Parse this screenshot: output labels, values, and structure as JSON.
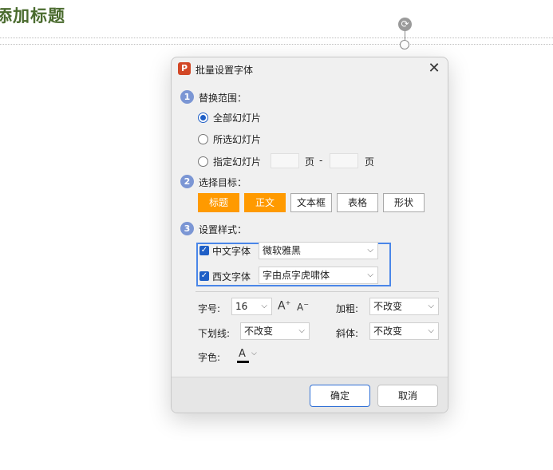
{
  "slide": {
    "title": "添加标题"
  },
  "dialog": {
    "title": "批量设置字体",
    "app_icon": "P",
    "close_glyph": "✕",
    "section1": {
      "num": "1",
      "label": "替换范围："
    },
    "range_options": [
      {
        "label": "全部幻灯片",
        "checked": true
      },
      {
        "label": "所选幻灯片",
        "checked": false
      },
      {
        "label": "指定幻灯片",
        "checked": false
      }
    ],
    "page_unit": "页",
    "page_dash": "-",
    "section2": {
      "num": "2",
      "label": "选择目标："
    },
    "targets": [
      "标题",
      "正文",
      "文本框",
      "表格",
      "形状"
    ],
    "section3": {
      "num": "3",
      "label": "设置样式："
    },
    "cn_font": {
      "label": "中文字体",
      "value": "微软雅黑"
    },
    "en_font": {
      "label": "西文字体",
      "value": "字由点字虎啸体"
    },
    "size": {
      "label": "字号:",
      "value": "16"
    },
    "grow_glyph": "A",
    "shrink_glyph": "A",
    "bold": {
      "label": "加粗:",
      "value": "不改变"
    },
    "underline": {
      "label": "下划线:",
      "value": "不改变"
    },
    "italic": {
      "label": "斜体:",
      "value": "不改变"
    },
    "color": {
      "label": "字色:",
      "glyph": "A"
    },
    "ok_label": "确定",
    "cancel_label": "取消"
  },
  "colors": {
    "accent_orange": "#ff9a00",
    "primary_blue": "#1f5fc6",
    "highlight_blue": "#4a86e8",
    "badge_blue": "#7b96d4",
    "title_green": "#4a6b2e"
  }
}
